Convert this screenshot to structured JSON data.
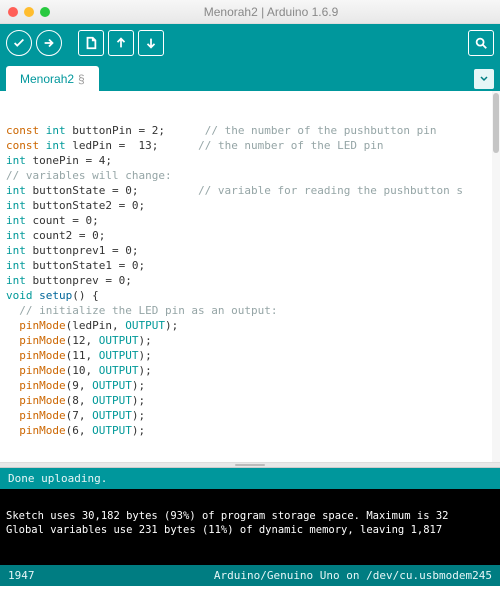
{
  "window": {
    "title": "Menorah2 | Arduino 1.6.9"
  },
  "tab": {
    "name": "Menorah2",
    "modified": "§"
  },
  "toolbar": {
    "verify": "Verify",
    "upload": "Upload",
    "new": "New",
    "open": "Open",
    "save": "Save",
    "monitor": "Serial Monitor"
  },
  "code_lines": [
    {
      "pre": "",
      "tokens": [
        {
          "t": "const",
          "c": "orange"
        },
        {
          "t": " ",
          "c": ""
        },
        {
          "t": "int",
          "c": "teal"
        },
        {
          "t": " buttonPin = 2;      ",
          "c": ""
        },
        {
          "t": "// the number of the pushbutton pin",
          "c": "comment"
        }
      ]
    },
    {
      "pre": "",
      "tokens": [
        {
          "t": "const",
          "c": "orange"
        },
        {
          "t": " ",
          "c": ""
        },
        {
          "t": "int",
          "c": "teal"
        },
        {
          "t": " ledPin =  13;      ",
          "c": ""
        },
        {
          "t": "// the number of the LED pin",
          "c": "comment"
        }
      ]
    },
    {
      "pre": "",
      "tokens": [
        {
          "t": "int",
          "c": "teal"
        },
        {
          "t": " tonePin = 4;",
          "c": ""
        }
      ]
    },
    {
      "pre": "",
      "tokens": [
        {
          "t": "",
          "c": ""
        }
      ]
    },
    {
      "pre": "",
      "tokens": [
        {
          "t": "// variables will change:",
          "c": "comment"
        }
      ]
    },
    {
      "pre": "",
      "tokens": [
        {
          "t": "int",
          "c": "teal"
        },
        {
          "t": " buttonState = 0;         ",
          "c": ""
        },
        {
          "t": "// variable for reading the pushbutton s",
          "c": "comment"
        }
      ]
    },
    {
      "pre": "",
      "tokens": [
        {
          "t": "int",
          "c": "teal"
        },
        {
          "t": " buttonState2 = 0;",
          "c": ""
        }
      ]
    },
    {
      "pre": "",
      "tokens": [
        {
          "t": "int",
          "c": "teal"
        },
        {
          "t": " count = 0;",
          "c": ""
        }
      ]
    },
    {
      "pre": "",
      "tokens": [
        {
          "t": "int",
          "c": "teal"
        },
        {
          "t": " count2 = 0;",
          "c": ""
        }
      ]
    },
    {
      "pre": "",
      "tokens": [
        {
          "t": "int",
          "c": "teal"
        },
        {
          "t": " buttonprev1 = 0;",
          "c": ""
        }
      ]
    },
    {
      "pre": "",
      "tokens": [
        {
          "t": "int",
          "c": "teal"
        },
        {
          "t": " buttonState1 = 0;",
          "c": ""
        }
      ]
    },
    {
      "pre": "",
      "tokens": [
        {
          "t": "int",
          "c": "teal"
        },
        {
          "t": " buttonprev = 0;",
          "c": ""
        }
      ]
    },
    {
      "pre": "",
      "tokens": [
        {
          "t": "void",
          "c": "teal"
        },
        {
          "t": " ",
          "c": ""
        },
        {
          "t": "setup",
          "c": "blue"
        },
        {
          "t": "() {",
          "c": ""
        }
      ]
    },
    {
      "pre": "  ",
      "tokens": [
        {
          "t": "// initialize the LED pin as an output:",
          "c": "comment"
        }
      ]
    },
    {
      "pre": "  ",
      "tokens": [
        {
          "t": "pinMode",
          "c": "func"
        },
        {
          "t": "(ledPin, ",
          "c": ""
        },
        {
          "t": "OUTPUT",
          "c": "teal"
        },
        {
          "t": ");",
          "c": ""
        }
      ]
    },
    {
      "pre": "  ",
      "tokens": [
        {
          "t": "pinMode",
          "c": "func"
        },
        {
          "t": "(12, ",
          "c": ""
        },
        {
          "t": "OUTPUT",
          "c": "teal"
        },
        {
          "t": ");",
          "c": ""
        }
      ]
    },
    {
      "pre": "  ",
      "tokens": [
        {
          "t": "pinMode",
          "c": "func"
        },
        {
          "t": "(11, ",
          "c": ""
        },
        {
          "t": "OUTPUT",
          "c": "teal"
        },
        {
          "t": ");",
          "c": ""
        }
      ]
    },
    {
      "pre": "  ",
      "tokens": [
        {
          "t": "pinMode",
          "c": "func"
        },
        {
          "t": "(10, ",
          "c": ""
        },
        {
          "t": "OUTPUT",
          "c": "teal"
        },
        {
          "t": ");",
          "c": ""
        }
      ]
    },
    {
      "pre": "  ",
      "tokens": [
        {
          "t": "pinMode",
          "c": "func"
        },
        {
          "t": "(9, ",
          "c": ""
        },
        {
          "t": "OUTPUT",
          "c": "teal"
        },
        {
          "t": ");",
          "c": ""
        }
      ]
    },
    {
      "pre": "  ",
      "tokens": [
        {
          "t": "pinMode",
          "c": "func"
        },
        {
          "t": "(8, ",
          "c": ""
        },
        {
          "t": "OUTPUT",
          "c": "teal"
        },
        {
          "t": ");",
          "c": ""
        }
      ]
    },
    {
      "pre": "  ",
      "tokens": [
        {
          "t": "pinMode",
          "c": "func"
        },
        {
          "t": "(7, ",
          "c": ""
        },
        {
          "t": "OUTPUT",
          "c": "teal"
        },
        {
          "t": ");",
          "c": ""
        }
      ]
    },
    {
      "pre": "  ",
      "tokens": [
        {
          "t": "pinMode",
          "c": "func"
        },
        {
          "t": "(6, ",
          "c": ""
        },
        {
          "t": "OUTPUT",
          "c": "teal"
        },
        {
          "t": ");",
          "c": ""
        }
      ]
    }
  ],
  "status": {
    "message": "Done uploading."
  },
  "console": {
    "line1": "Sketch uses 30,182 bytes (93%) of program storage space. Maximum is 32",
    "line2": "Global variables use 231 bytes (11%) of dynamic memory, leaving 1,817 "
  },
  "footer": {
    "line": "1947",
    "board": "Arduino/Genuino Uno on /dev/cu.usbmodem245"
  }
}
